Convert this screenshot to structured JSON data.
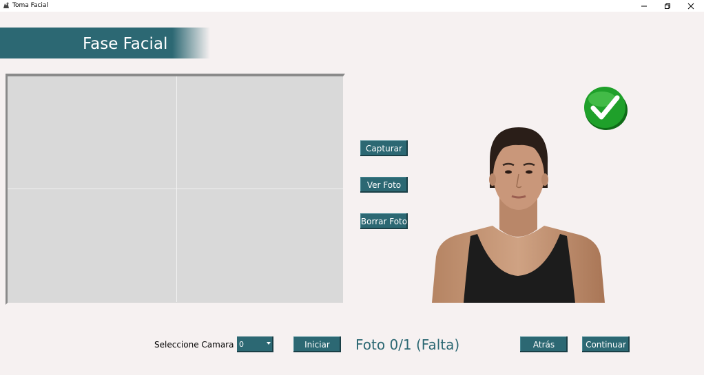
{
  "window": {
    "title": "Toma Facial"
  },
  "header": {
    "title": "Fase Facial"
  },
  "actions": {
    "capture_label": "Capturar",
    "view_photo_label": "Ver Foto",
    "delete_photo_label": "Borrar Foto"
  },
  "reference": {
    "status_icon": "check-icon"
  },
  "footer": {
    "camera_label": "Seleccione Camara",
    "camera_value": "0",
    "start_label": "Iniciar",
    "photo_status": "Foto 0/1 (Falta)",
    "back_label": "Atrás",
    "continue_label": "Continuar"
  },
  "colors": {
    "accent": "#2c6873",
    "background": "#f6f1f1",
    "preview": "#d9d9d9",
    "success": "#1fa02a"
  }
}
